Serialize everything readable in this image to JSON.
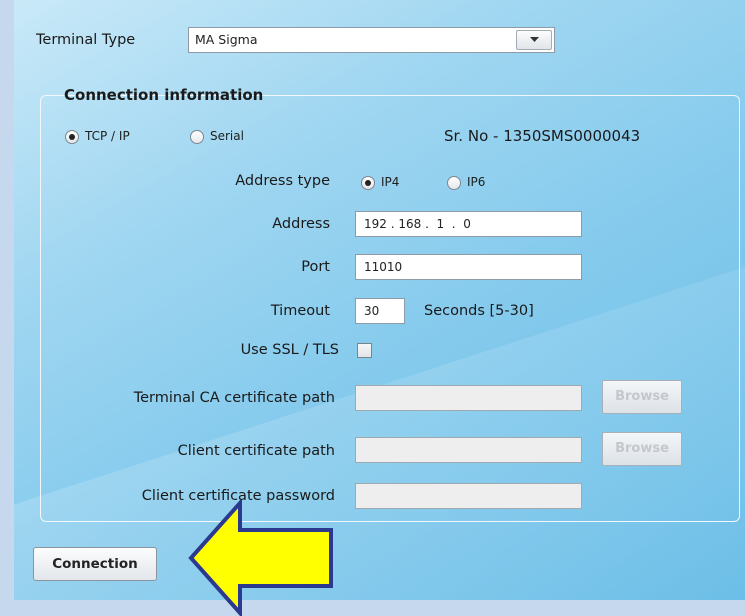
{
  "terminal_type": {
    "label": "Terminal Type",
    "value": "MA Sigma"
  },
  "connection_group": {
    "title": "Connection information",
    "mode_options": [
      {
        "label": "TCP / IP",
        "selected": true
      },
      {
        "label": "Serial",
        "selected": false
      }
    ],
    "serial_number": "Sr. No  -  1350SMS0000043",
    "address_type": {
      "label": "Address type",
      "options": [
        {
          "label": "IP4",
          "selected": true
        },
        {
          "label": "IP6",
          "selected": false
        }
      ]
    },
    "address": {
      "label": "Address",
      "value": "192 . 168 .  1  .  0"
    },
    "port": {
      "label": "Port",
      "value": "11010"
    },
    "timeout": {
      "label": "Timeout",
      "value": "30",
      "unit": "Seconds [5-30]"
    },
    "ssl": {
      "label": "Use SSL / TLS",
      "checked": false
    },
    "terminal_ca_cert": {
      "label": "Terminal CA certificate path",
      "value": "",
      "browse_label": "Browse"
    },
    "client_cert": {
      "label": "Client certificate path",
      "value": "",
      "browse_label": "Browse"
    },
    "client_cert_password": {
      "label": "Client certificate password",
      "value": ""
    }
  },
  "connection_button": {
    "label": "Connection"
  },
  "colors": {
    "arrow_fill": "#ffff00",
    "arrow_stroke": "#2b3a8f"
  }
}
